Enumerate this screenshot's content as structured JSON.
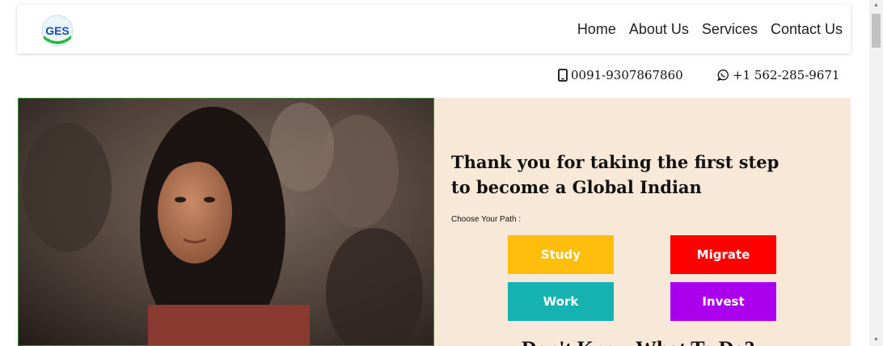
{
  "nav": {
    "logo_text": "GES",
    "links": [
      "Home",
      "About Us",
      "Services",
      "Contact Us"
    ]
  },
  "contact": {
    "phone": "0091-9307867860",
    "whatsapp": "+1 562-285-9671"
  },
  "hero": {
    "headline": "Thank you for taking the first step to become a Global Indian",
    "path_label": "Choose Your Path :",
    "buttons": {
      "study": "Study",
      "migrate": "Migrate",
      "work": "Work",
      "invest": "Invest"
    },
    "dont_know": "Don't Know What To Do?"
  },
  "colors": {
    "study": "#ffbe0b",
    "migrate": "#ff0000",
    "work": "#16b2b2",
    "invest": "#aa00ee",
    "panel_bg": "#f8e8d8"
  },
  "icons": {
    "phone": "mobile-phone-icon",
    "whatsapp": "whatsapp-icon"
  }
}
